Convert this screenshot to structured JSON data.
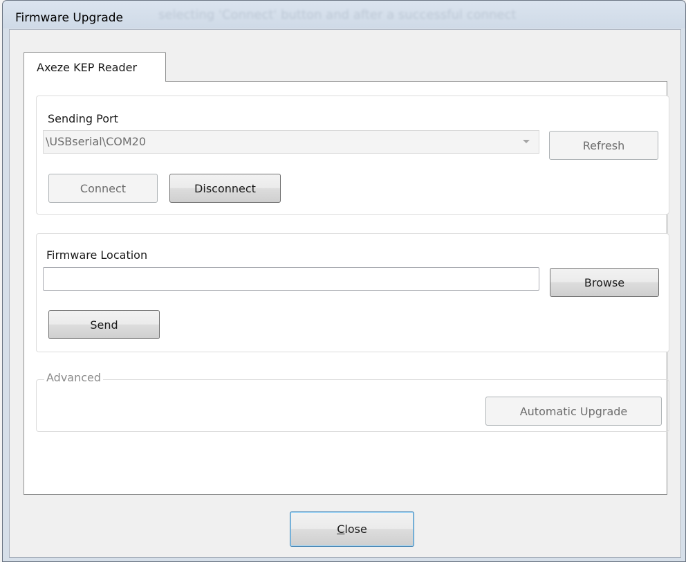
{
  "window": {
    "title": "Firmware Upgrade",
    "background_text": "selecting 'Connect' button and after a successful connect"
  },
  "tabs": [
    {
      "label": "Axeze KEP Reader",
      "selected": true
    }
  ],
  "sending_port": {
    "label": "Sending Port",
    "port_value": "\\USBserial\\COM20",
    "refresh_label": "Refresh",
    "connect_label": "Connect",
    "disconnect_label": "Disconnect"
  },
  "firmware": {
    "label": "Firmware Location",
    "location_value": "",
    "browse_label": "Browse",
    "send_label": "Send"
  },
  "advanced": {
    "legend": "Advanced",
    "automatic_upgrade_label": "Automatic Upgrade"
  },
  "footer": {
    "close_label": "Close",
    "close_mnemonic": "C",
    "close_rest": "lose"
  },
  "colors": {
    "default_button_border": "#3c7fb1",
    "disabled_text": "#6d6d6d"
  }
}
